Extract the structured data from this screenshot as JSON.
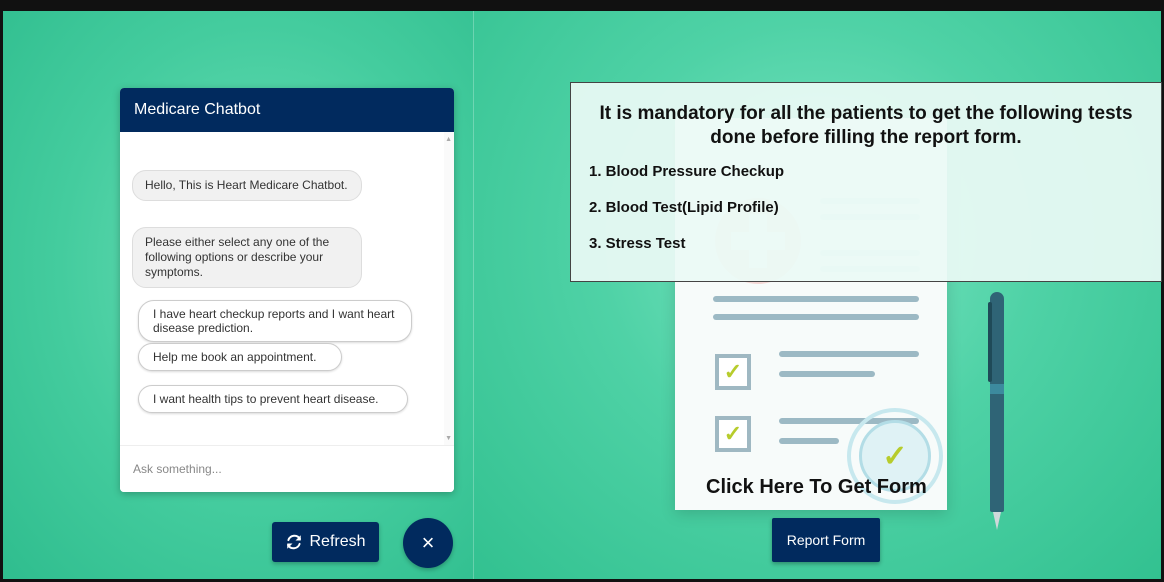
{
  "chat": {
    "title": "Medicare Chatbot",
    "messages": [
      "Hello, This is Heart Medicare Chatbot.",
      "Please either select any one of the following options or describe your symptoms."
    ],
    "options": [
      "I have heart checkup reports and I want heart disease prediction.",
      "Help me book an appointment.",
      "I want health tips to prevent heart disease."
    ],
    "input_placeholder": "Ask something...",
    "refresh_label": "Refresh",
    "close_label": "×",
    "refresh_icon": "refresh-icon",
    "close_icon": "close-icon"
  },
  "notice": {
    "title": "It is mandatory for all the patients to get the following tests done before filling the report form.",
    "tests": [
      "1. Blood Pressure Checkup",
      "2. Blood Test(Lipid Profile)",
      "3. Stress Test"
    ]
  },
  "report": {
    "link_text": "Click Here To Get Form",
    "button_label": "Report Form"
  },
  "colors": {
    "brand": "#012a5e",
    "background": "#3ec89a",
    "check": "#b7cc2c"
  }
}
